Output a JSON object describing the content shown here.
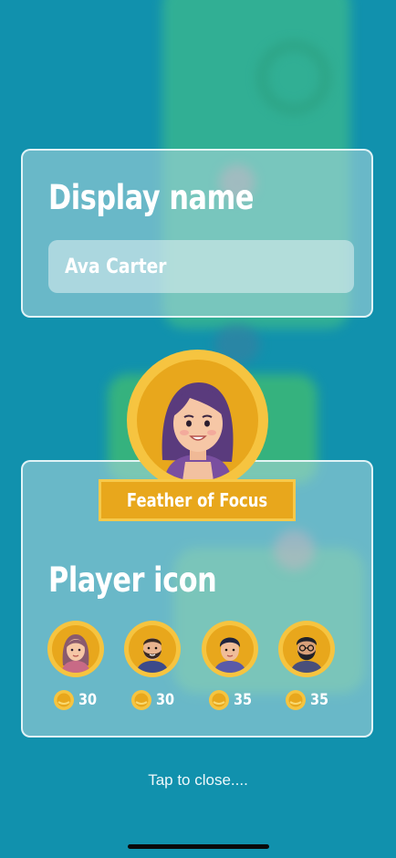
{
  "display_name": {
    "heading": "Display name",
    "value": "Ava Carter"
  },
  "profile": {
    "title_badge": "Feather of Focus"
  },
  "player_icon": {
    "heading": "Player icon",
    "options": [
      {
        "price": "30",
        "icon": "woman-avatar-icon"
      },
      {
        "price": "30",
        "icon": "bearded-man-avatar-icon"
      },
      {
        "price": "35",
        "icon": "man-avatar-icon"
      },
      {
        "price": "35",
        "icon": "bearded-man-glasses-avatar-icon"
      }
    ]
  },
  "footer": {
    "tap_to_close": "Tap to close...."
  },
  "colors": {
    "background": "#1191ad",
    "card": "#b3d8de",
    "gold": "#e8a71c",
    "gold_light": "#f6c440"
  }
}
